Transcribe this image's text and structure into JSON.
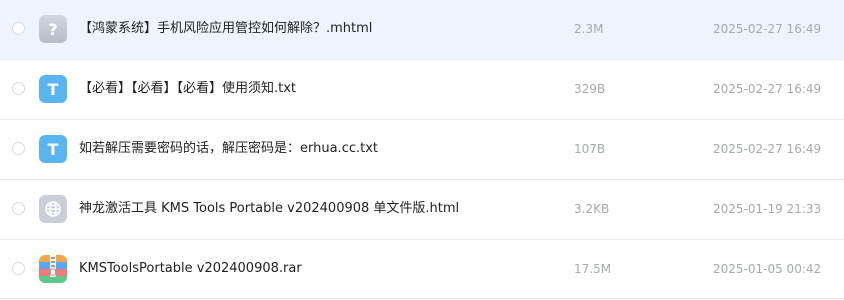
{
  "files": [
    {
      "name": "【鸿蒙系统】手机风险应用管控如何解除？.mhtml",
      "size": "2.3M",
      "date": "2025-02-27 16:49",
      "icon": "unknown-file-icon",
      "selected": true
    },
    {
      "name": "【必看】【必看】【必看】使用须知.txt",
      "size": "329B",
      "date": "2025-02-27 16:49",
      "icon": "text-file-icon",
      "selected": false
    },
    {
      "name": "如若解压需要密码的话，解压密码是：erhua.cc.txt",
      "size": "107B",
      "date": "2025-02-27 16:49",
      "icon": "text-file-icon",
      "selected": false
    },
    {
      "name": "神龙激活工具 KMS Tools Portable v202400908 单文件版.html",
      "size": "3.2KB",
      "date": "2025-01-19 21:33",
      "icon": "web-file-icon",
      "selected": false
    },
    {
      "name": "KMSToolsPortable v202400908.rar",
      "size": "17.5M",
      "date": "2025-01-05 00:42",
      "icon": "archive-file-icon",
      "selected": false
    }
  ],
  "icon_glyphs": {
    "unknown": "?",
    "text": "T"
  },
  "colors": {
    "selected_row": "#eef3fe",
    "text_icon": "#5ab4f0",
    "unknown_icon": "#c4c8d2",
    "web_icon": "#c9ced8",
    "meta_text": "#a5a9b0"
  }
}
